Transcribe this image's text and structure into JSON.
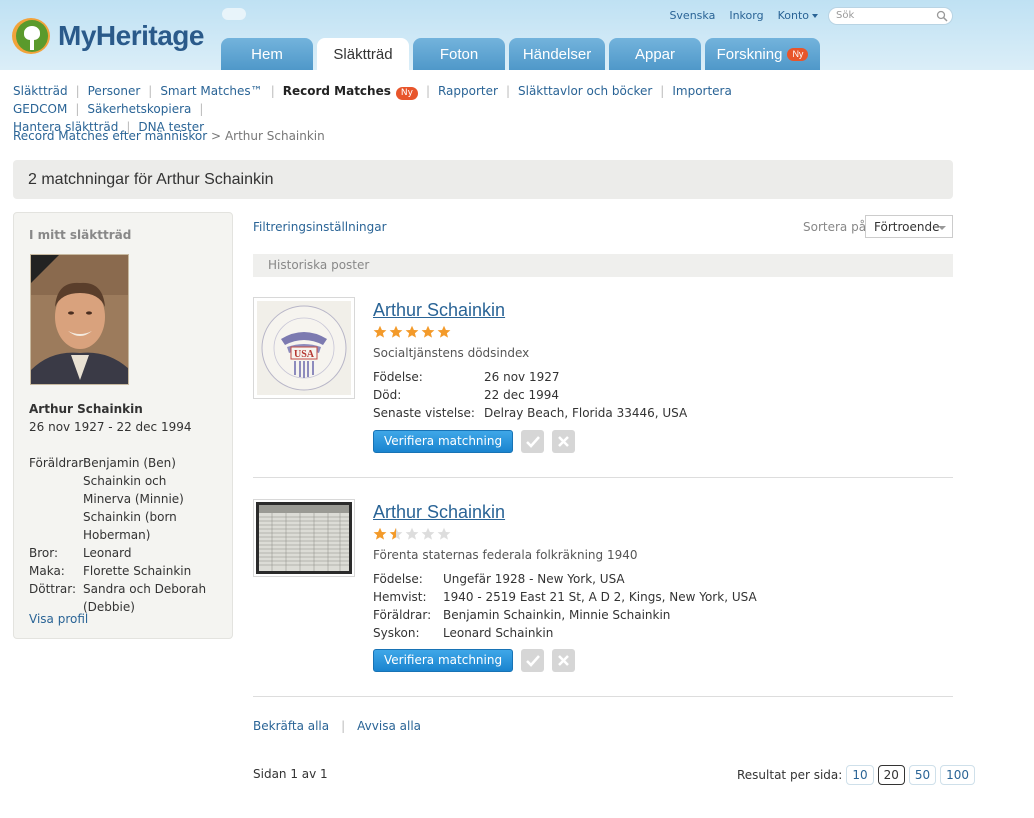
{
  "header": {
    "logo_text": "MyHeritage",
    "toplinks": [
      "Svenska",
      "Inkorg",
      "Konto"
    ],
    "search_placeholder": "Sök",
    "tabs": [
      {
        "label": "Hem"
      },
      {
        "label": "Släktträd"
      },
      {
        "label": "Foton"
      },
      {
        "label": "Händelser"
      },
      {
        "label": "Appar"
      },
      {
        "label": "Forskning",
        "badge": "Ny"
      }
    ]
  },
  "subnav": {
    "items": [
      "Släktträd",
      "Personer",
      "Smart Matches™",
      "Record Matches",
      "Rapporter",
      "Släkttavlor och böcker",
      "Importera GEDCOM",
      "Säkerhetskopiera",
      "Hantera släktträd",
      "DNA tester"
    ],
    "badge": "Ny"
  },
  "breadcrumb": {
    "link": "Record Matches efter människor",
    "separator": ">",
    "current": "Arthur Schainkin"
  },
  "page_title": "2 matchningar för Arthur Schainkin",
  "tree_panel": {
    "heading": "I mitt släktträd",
    "name": "Arthur Schainkin",
    "dates": "26 nov 1927 - 22 dec 1994",
    "relatives": [
      {
        "label": "Föräldrar:",
        "value": "Benjamin (Ben) Schainkin och Minerva (Minnie) Schainkin (born Hoberman)"
      },
      {
        "label": "Bror:",
        "value": "Leonard"
      },
      {
        "label": "Maka:",
        "value": "Florette Schainkin"
      },
      {
        "label": "Döttrar:",
        "value": "Sandra och Deborah (Debbie)"
      }
    ],
    "view_profile": "Visa profil"
  },
  "filter_link": "Filtreringsinställningar",
  "sort": {
    "label": "Sortera på",
    "value": "Förtroende"
  },
  "section_label": "Historiska poster",
  "matches": [
    {
      "name": "Arthur Schainkin",
      "rating": 5,
      "source": "Socialtjänstens dödsindex",
      "thumb_text": "USA",
      "fields": [
        {
          "label": "Födelse:",
          "value": "26 nov 1927"
        },
        {
          "label": "Död:",
          "value": "22 dec 1994"
        },
        {
          "label": "Senaste vistelse:",
          "value": "Delray Beach, Florida 33446, USA"
        }
      ],
      "verify_label": "Verifiera matchning"
    },
    {
      "name": "Arthur Schainkin",
      "rating": 1.5,
      "source": "Förenta staternas federala folkräkning 1940",
      "fields": [
        {
          "label": "Födelse:",
          "value": "Ungefär 1928 - New York, USA"
        },
        {
          "label": "Hemvist:",
          "value": "1940 - 2519 East 21 St, A D 2, Kings, New York, USA"
        },
        {
          "label": "Föräldrar:",
          "value": "Benjamin Schainkin, Minnie Schainkin"
        },
        {
          "label": "Syskon:",
          "value": "Leonard Schainkin"
        }
      ],
      "verify_label": "Verifiera matchning"
    }
  ],
  "bulk_actions": {
    "confirm_all": "Bekräfta alla",
    "reject_all": "Avvisa alla"
  },
  "pagination": {
    "page_info": "Sidan 1 av 1",
    "per_page_label": "Resultat per sida:",
    "options": [
      "10",
      "20",
      "50",
      "100"
    ],
    "selected": "20"
  },
  "colors": {
    "link": "#2a6496",
    "tab": "#4f98c9",
    "badge": "#e8552b",
    "star_on": "#f39a2a",
    "star_off": "#dddddd",
    "verify": "#1a84cf"
  }
}
